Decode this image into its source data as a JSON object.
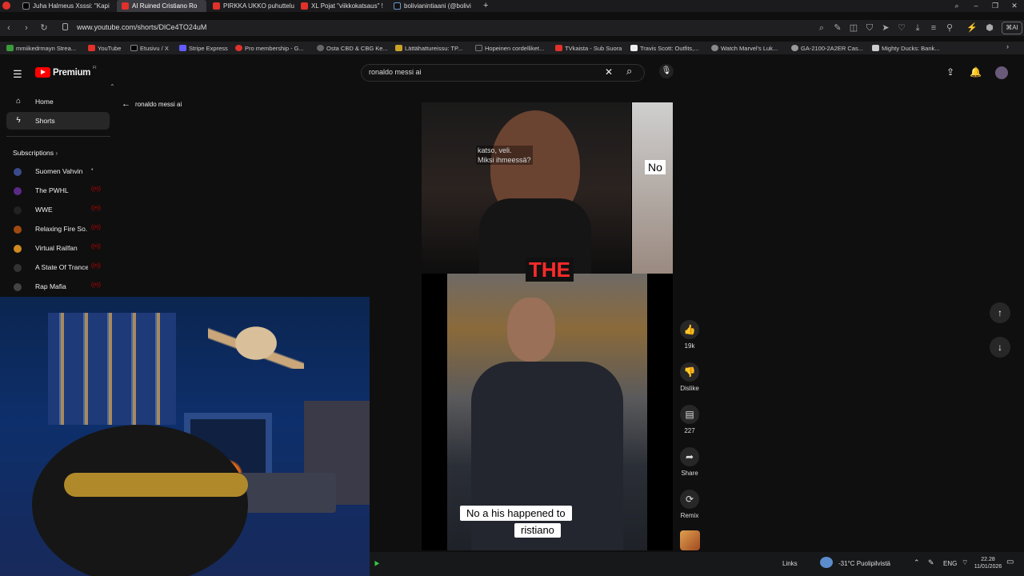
{
  "tabs": [
    {
      "title": "Juha Halmeus Xsssi: \"Kapi",
      "icon": "x-icon"
    },
    {
      "title": "AI Ruined Cristiano Ro",
      "icon": "youtube-icon",
      "active": true
    },
    {
      "title": "PIRKKA UKKO puhuttelun",
      "icon": "youtube-icon"
    },
    {
      "title": "XL Pojat \"viikkokatsaus\" !",
      "icon": "youtube-icon"
    },
    {
      "title": "bolivianintiaani (@bolivi",
      "icon": "tiktok-icon"
    }
  ],
  "address": {
    "url": "www.youtube.com/shorts/DlCe4TO24uM"
  },
  "bookmarks": [
    "mmiikedrmayn Strea...",
    "YouTube",
    "Etusivu / X",
    "Stripe Express",
    "Pro membership - G...",
    "Osta CBD & CBG Ke...",
    "Lättähattureissu: TP...",
    "Hopeinen cordelliket...",
    "TVkaista - Sub Suora",
    "Travis Scott: Outfits,...",
    "Watch Marvel's Luk...",
    "GA-2100-2A2ER Cas...",
    "Mighty Ducks: Bank..."
  ],
  "youtube": {
    "logo": "Premium",
    "logo_sup": "FI",
    "search_value": "ronaldo messi ai",
    "back_label": "ronaldo messi ai",
    "nav": [
      {
        "label": "Home",
        "icon": "home-icon"
      },
      {
        "label": "Shorts",
        "icon": "shorts-icon"
      }
    ],
    "subscriptions_label": "Subscriptions",
    "subscriptions": [
      {
        "name": "Suomen Vahvin",
        "color": "#3b4a8a"
      },
      {
        "name": "The PWHL",
        "color": "#5b2a86"
      },
      {
        "name": "WWE",
        "color": "#222222"
      },
      {
        "name": "Relaxing Fire So...",
        "color": "#a04a10"
      },
      {
        "name": "Virtual Railfan",
        "color": "#d08a20"
      },
      {
        "name": "A State Of Trance",
        "color": "#333333"
      },
      {
        "name": "Rap Mafia",
        "color": "#444444"
      }
    ],
    "actions": [
      {
        "icon": "like-icon",
        "label": "19k"
      },
      {
        "icon": "dislike-icon",
        "label": "Dislike"
      },
      {
        "icon": "comment-icon",
        "label": "227"
      },
      {
        "icon": "share-icon",
        "label": "Share"
      },
      {
        "icon": "remix-icon",
        "label": "Remix"
      }
    ],
    "video": {
      "subtitle_line1": "katso, veli.",
      "subtitle_line2": "Miksi ihmeessä?",
      "big_word": "THE",
      "side_text": "No",
      "caption_line1": "No a  his happened to",
      "caption_line2": "ristiano"
    }
  },
  "taskbar": {
    "links": "Links",
    "weather": "-31°C Puolipilvistä",
    "lang": "ENG",
    "time": "22.28",
    "date": "11/01/2026"
  },
  "colors": {
    "accent": "#ff0000",
    "background": "#0f0f0f"
  }
}
